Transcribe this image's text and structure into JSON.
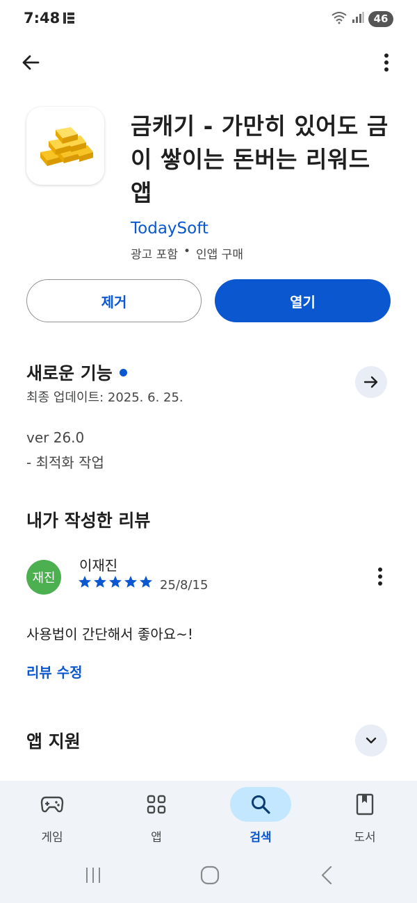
{
  "status_bar": {
    "time": "7:48",
    "battery": "46",
    "icons": [
      "notification-icon",
      "wifi-icon",
      "signal-icon",
      "battery-icon"
    ]
  },
  "top_bar": {
    "icons": [
      "back-arrow-icon",
      "more-vert-icon"
    ]
  },
  "app": {
    "icon": "gold-bars-icon",
    "title": "금캐기 - 가만히 있어도 금이 쌓이는 돈버는 리워드 앱",
    "developer": "TodaySoft",
    "meta": [
      "광고 포함",
      "•",
      "인앱 구매"
    ]
  },
  "actions": {
    "remove_label": "제거",
    "open_label": "열기"
  },
  "whats_new": {
    "title": "새로운 기능",
    "updated": "최종 업데이트: 2025. 6. 25.",
    "notes": [
      "ver 26.0",
      "- 최적화 작업"
    ],
    "arrow_icon": "arrow-forward-icon"
  },
  "my_review": {
    "title": "내가 작성한 리뷰",
    "avatar_text": "재진",
    "reviewer": "이재진",
    "rating": 5,
    "rating_max": 5,
    "date": "25/8/15",
    "text": "사용법이 간단해서 좋아요~!",
    "edit_label": "리뷰 수정"
  },
  "app_support": {
    "title": "앱 지원",
    "expand_icon": "expand-more-icon"
  },
  "bottom_nav": {
    "items": [
      {
        "label": "게임",
        "icon": "gamepad-icon",
        "active": false
      },
      {
        "label": "앱",
        "icon": "apps-grid-icon",
        "active": false
      },
      {
        "label": "검색",
        "icon": "search-icon",
        "active": true
      },
      {
        "label": "도서",
        "icon": "book-icon",
        "active": false
      }
    ]
  },
  "system_nav": [
    "recents-icon",
    "home-icon",
    "back-icon"
  ],
  "colors": {
    "accent": "#0b57d0",
    "active_pill": "#c2e7ff",
    "nav_background": "#f0f4f9",
    "avatar": "#4caf50"
  }
}
